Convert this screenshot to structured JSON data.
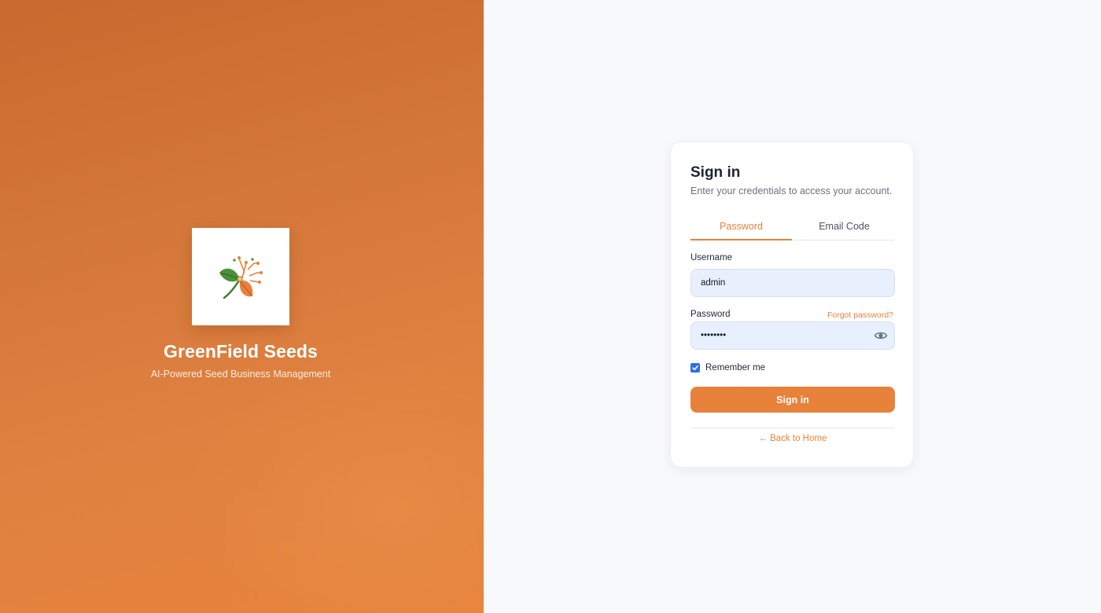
{
  "brand": {
    "name": "GreenField Seeds",
    "tagline": "AI-Powered Seed Business Management",
    "logo_icon": "leaf-circuit-logo",
    "gradient_colors": [
      "#c9692f",
      "#e8833c"
    ]
  },
  "login": {
    "title": "Sign in",
    "subtitle": "Enter your credentials to access your account.",
    "tabs": [
      {
        "label": "Password",
        "active": true
      },
      {
        "label": "Email Code",
        "active": false
      }
    ],
    "username_label": "Username",
    "username_value": "admin",
    "password_label": "Password",
    "password_value": "password",
    "forgot_password": "Forgot password?",
    "show_password_icon": "eye-icon",
    "remember_me_label": "Remember me",
    "remember_me_checked": true,
    "submit_label": "Sign in",
    "back_link": "Back to Home",
    "back_icon": "arrow-left-icon"
  },
  "colors": {
    "accent": "#e8813a",
    "checkbox": "#2f6fe4",
    "input_bg": "#e8f0fe",
    "page_bg": "#f8f9fb"
  }
}
